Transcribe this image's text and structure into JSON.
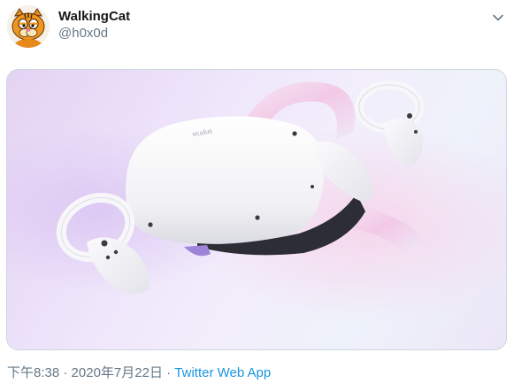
{
  "tweet": {
    "author": {
      "display_name": "WalkingCat",
      "handle": "@h0x0d",
      "avatar_icon": "garfield-cat-avatar"
    },
    "media": {
      "alt_icon": "vr-headset-image",
      "brand_text": "oculus"
    },
    "meta": {
      "time": "下午8:38",
      "separator1": " · ",
      "date": "2020年7月22日",
      "separator2": " · ",
      "source": "Twitter Web App"
    },
    "menu_icon": "chevron-down-icon"
  },
  "colors": {
    "name": "#14171a",
    "secondary": "#657786",
    "link": "#1b95e0",
    "border": "#ccd6dd"
  }
}
